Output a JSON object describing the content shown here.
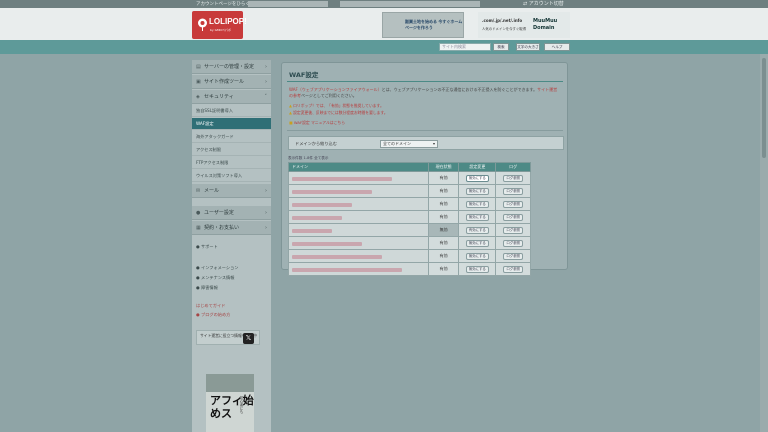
{
  "topbar": {
    "account_text": "アカウントページをひらく",
    "account_switch": "アカウント切替"
  },
  "header": {
    "logo_text": "LOLIPOP!",
    "logo_sub": "by GMOペパボ",
    "banner1_text": "副業土地を始める 今すぐホームページを作ろう",
    "banner2_domains": ".com/.jp/.net/.info",
    "banner2_caption": "人気のドメインを今すぐ取得",
    "banner2_brand": "MuuMuu Domain"
  },
  "nav": {
    "search_placeholder": "サイト内検索",
    "search_button": "検索",
    "btn_font": "文字の大きさ",
    "btn_help": "ヘルプ"
  },
  "sidebar": {
    "items": [
      {
        "label": "サーバーの管理・設定",
        "icon": "server-icon"
      },
      {
        "label": "サイト作成ツール",
        "icon": "tools-icon"
      },
      {
        "label": "セキュリティ",
        "icon": "shield-icon"
      }
    ],
    "subitems": [
      {
        "label": "独自SSL証明書導入"
      },
      {
        "label": "WAF設定"
      },
      {
        "label": "海外アタックガード"
      },
      {
        "label": "アクセス制限"
      },
      {
        "label": "FTPアクセス制限"
      },
      {
        "label": "ウイルス対策ソフト導入"
      }
    ],
    "items2": [
      {
        "label": "メール",
        "icon": "mail-icon"
      },
      {
        "label": "ユーザー設定",
        "icon": "user-icon"
      },
      {
        "label": "契約・お支払い",
        "icon": "wallet-icon"
      }
    ],
    "links": [
      "サポート",
      "インフォメーション",
      "メンテナンス情報",
      "障害情報",
      "はじめてガイド",
      "ブログの始め方"
    ],
    "x_box_text": "サイト運営に役立つ情報を発信中",
    "ad_title": "アフィ始めス",
    "ad_side": "初心者にも"
  },
  "main": {
    "title": "WAF設定",
    "intro_prefix": "WAF（ウェブアプリケーションファイアウォール）",
    "intro_body": "とは、ウェブアプリケーションの不正な通信における不正侵入を防ぐことができます。",
    "intro_link": "サイト運営の参考",
    "intro_suffix": "ページとしてご利用ください。",
    "notes": [
      "ロリポップ！では、「有効」状態を推奨しています。",
      "設定変更後、反映までには数分程度お時間を要します。"
    ],
    "manual_link": "WAF設定 マニュアルはこちら",
    "filter_label": "ドメインから絞り込む",
    "filter_value": "全てのドメイン",
    "count_text": "表示件数 1-8件 全て表示",
    "table": {
      "headers": [
        "ドメイン",
        "現在状態",
        "設定変更",
        "ログ"
      ],
      "rows": [
        {
          "status": "有効",
          "change": "無効にする",
          "log": "ログ参照"
        },
        {
          "status": "有効",
          "change": "無効にする",
          "log": "ログ参照"
        },
        {
          "status": "有効",
          "change": "無効にする",
          "log": "ログ参照"
        },
        {
          "status": "有効",
          "change": "無効にする",
          "log": "ログ参照"
        },
        {
          "status": "無効",
          "change": "有効にする",
          "log": "ログ参照"
        },
        {
          "status": "有効",
          "change": "無効にする",
          "log": "ログ参照"
        },
        {
          "status": "有効",
          "change": "無効にする",
          "log": "ログ参照"
        },
        {
          "status": "有効",
          "change": "無効にする",
          "log": "ログ参照"
        }
      ]
    }
  }
}
